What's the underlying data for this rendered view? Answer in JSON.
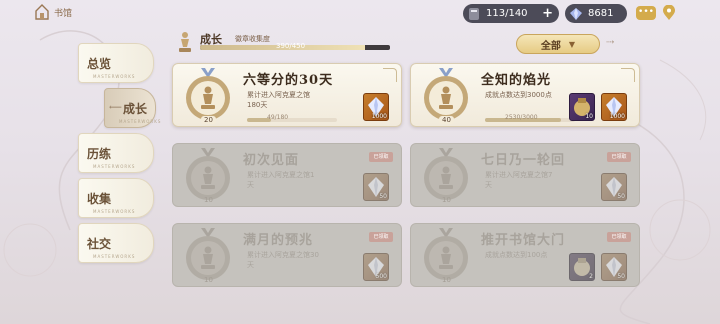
{
  "topbar": {
    "home_label": "书馆",
    "stamina": "113/140",
    "stamina_plus": "+",
    "crystal": "8681",
    "chat_label": "•••"
  },
  "collection": {
    "title": "成长",
    "subtitle": "徽章收集度",
    "progress_text": "390/450",
    "progress": 0.867
  },
  "filter": {
    "label": "全部",
    "arrow": "▼",
    "next": "⇢"
  },
  "nav": [
    {
      "label": "总览",
      "sublabel": "MASTERWORKS",
      "active": false
    },
    {
      "label": "成长",
      "sublabel": "MASTERWORKS",
      "active": true,
      "arrow": "⟵"
    },
    {
      "label": "历练",
      "sublabel": "MASTERWORKS",
      "active": false
    },
    {
      "label": "收集",
      "sublabel": "MASTERWORKS",
      "active": false
    },
    {
      "label": "社交",
      "sublabel": "MASTERWORKS",
      "active": false
    }
  ],
  "achievements": [
    {
      "title": "六等分的30天",
      "desc": "累计进入阿克夏之馆180天",
      "level": "20",
      "progress_text": "49/180",
      "progress": 0.27,
      "state": "done",
      "rewards": [
        {
          "type": "crystal",
          "count": "1000"
        }
      ]
    },
    {
      "title": "全知的焰光",
      "desc": "成就点数达到3000点",
      "level": "40",
      "progress_text": "2530/3000",
      "progress": 0.84,
      "state": "done",
      "rewards": [
        {
          "type": "bag",
          "count": "10"
        },
        {
          "type": "crystal",
          "count": "1000"
        }
      ]
    },
    {
      "title": "初次见面",
      "desc": "累计进入阿克夏之馆1天",
      "level": "10",
      "state": "locked",
      "lock_label": "已领取",
      "rewards": [
        {
          "type": "crystal",
          "count": "50"
        }
      ]
    },
    {
      "title": "七日乃一轮回",
      "desc": "累计进入阿克夏之馆7天",
      "level": "10",
      "state": "locked",
      "lock_label": "已领取",
      "rewards": [
        {
          "type": "crystal",
          "count": "50"
        }
      ]
    },
    {
      "title": "满月的预兆",
      "desc": "累计进入阿克夏之馆30天",
      "level": "10",
      "state": "locked",
      "lock_label": "已领取",
      "rewards": [
        {
          "type": "crystal",
          "count": "500"
        }
      ]
    },
    {
      "title": "推开书馆大门",
      "desc": "成就点数达到100点",
      "level": "10",
      "state": "locked",
      "lock_label": "已领取",
      "rewards": [
        {
          "type": "bag",
          "count": "2"
        },
        {
          "type": "crystal",
          "count": "50"
        }
      ]
    }
  ]
}
